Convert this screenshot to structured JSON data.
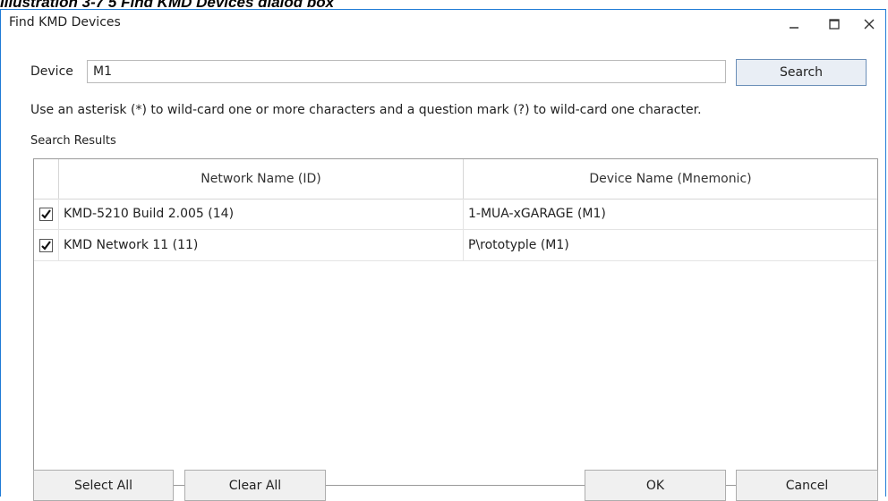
{
  "caption": "Illustration 3-7 5 Find KMD Devices dialog box",
  "window": {
    "title": "Find KMD Devices",
    "controls": {
      "minimize_icon": "minimize-icon",
      "maximize_icon": "maximize-icon",
      "close_icon": "close-icon"
    }
  },
  "search": {
    "device_label": "Device",
    "device_value": "M1",
    "search_button": "Search",
    "hint": "Use an asterisk (*) to wild-card one or more characters and a question mark (?) to wild-card one character."
  },
  "results": {
    "label": "Search Results",
    "columns": [
      "Network Name (ID)",
      "Device Name (Mnemonic)"
    ],
    "rows": [
      {
        "checked": true,
        "network": "KMD-5210 Build 2.005 (14)",
        "device": "1-MUA-xGARAGE (M1)"
      },
      {
        "checked": true,
        "network": "KMD Network 11 (11)",
        "device": "P\\rototyple (M1)"
      }
    ]
  },
  "footer": {
    "select_all": "Select All",
    "clear_all": "Clear All",
    "ok": "OK",
    "cancel": "Cancel"
  }
}
